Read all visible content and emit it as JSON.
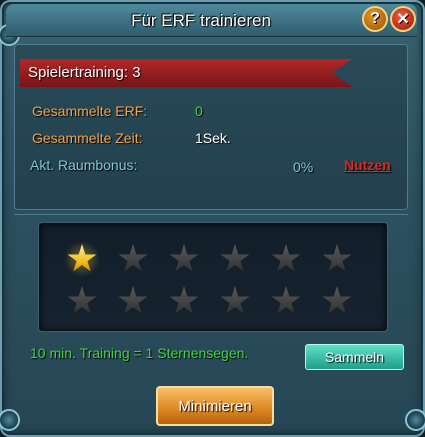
{
  "window": {
    "title": "Für ERF trainieren",
    "help_label": "?",
    "close_label": "✕"
  },
  "training": {
    "header_label": "Spielertraining: 3",
    "rows": [
      {
        "label": "Gesammelte ERF:",
        "value": "0"
      },
      {
        "label": "Gesammelte Zeit:",
        "value": "1Sek."
      }
    ],
    "room_bonus": {
      "label": "Akt. Raumbonus:",
      "value": "0%",
      "action_label": "Nutzen"
    }
  },
  "stars": {
    "total": 12,
    "earned": 1
  },
  "footer": {
    "info_text": "10 min. Training = 1 Sternensegen.",
    "collect_label": "Sammeln",
    "minimize_label": "Minimieren"
  },
  "colors": {
    "label_orange": "#f0a24c",
    "value_green": "#3ed43e",
    "link_red": "#e0261e",
    "ribbon_red": "#b0282a",
    "star_gold": "#f3c022"
  }
}
